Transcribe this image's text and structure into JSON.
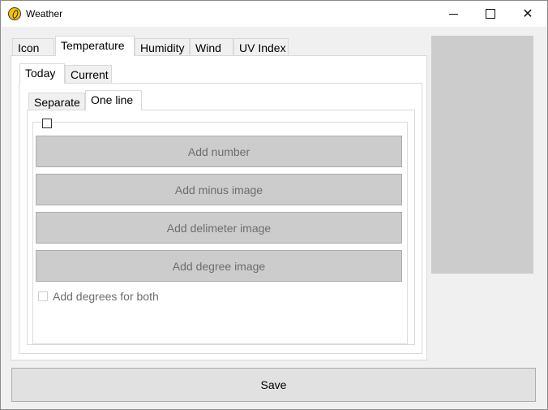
{
  "window": {
    "title": "Weather",
    "close_glyph": "✕"
  },
  "main_tabs": [
    "Icon",
    "Temperature",
    "Humidity",
    "Wind",
    "UV Index"
  ],
  "sub_tabs": [
    "Today",
    "Current"
  ],
  "inner_tabs": [
    "Separate",
    "One line"
  ],
  "buttons": {
    "add_number": "Add number",
    "add_minus_image": "Add minus image",
    "add_delimeter_image": "Add delimeter image",
    "add_degree_image": "Add degree image",
    "save": "Save"
  },
  "checkbox": {
    "label": "Add degrees for both"
  },
  "colors": {
    "disabled_button": "#cccccc",
    "preview_box": "#cccccc"
  }
}
